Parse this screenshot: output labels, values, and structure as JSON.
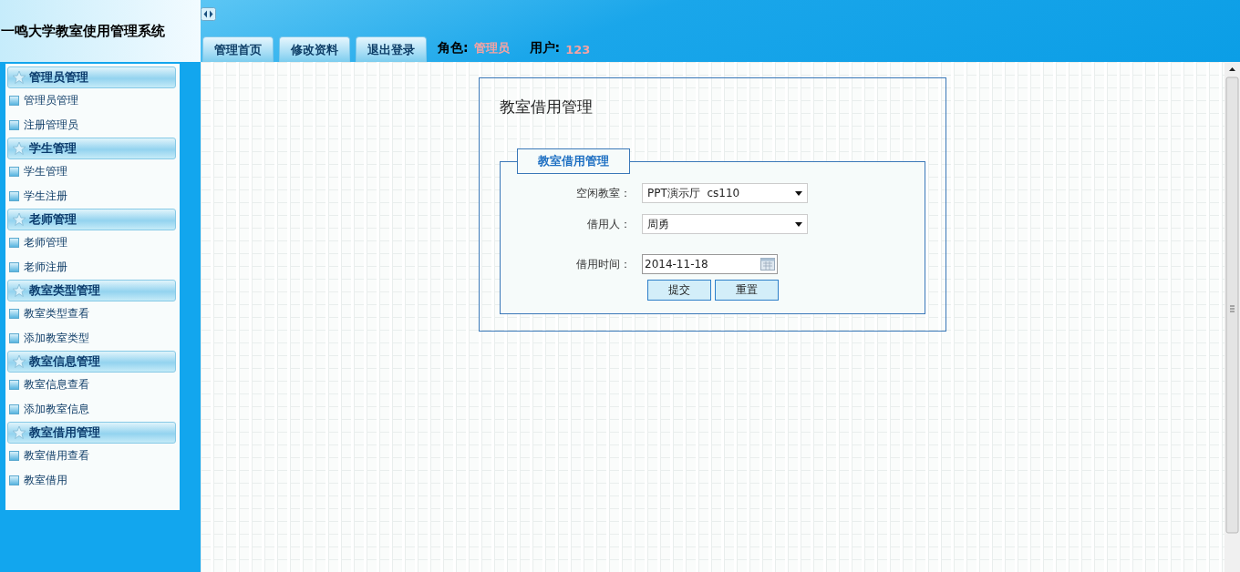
{
  "header": {
    "title": "一鸣大学教室使用管理系统",
    "nav": [
      "管理首页",
      "修改资料",
      "退出登录"
    ],
    "role_label": "角色:",
    "role": "管理员",
    "user_label": "用户:",
    "user": "123"
  },
  "sidebar": {
    "groups": [
      {
        "title": "管理员管理",
        "items": [
          "管理员管理",
          "注册管理员"
        ]
      },
      {
        "title": "学生管理",
        "items": [
          "学生管理",
          "学生注册"
        ]
      },
      {
        "title": "老师管理",
        "items": [
          "老师管理",
          "老师注册"
        ]
      },
      {
        "title": "教室类型管理",
        "items": [
          "教室类型查看",
          "添加教室类型"
        ]
      },
      {
        "title": "教室信息管理",
        "items": [
          "教室信息查看",
          "添加教室信息"
        ]
      },
      {
        "title": "教室借用管理",
        "items": [
          "教室借用查看",
          "教室借用"
        ]
      }
    ]
  },
  "page": {
    "title": "教室借用管理",
    "legend": "教室借用管理",
    "fields": [
      {
        "kind": "select",
        "label": "空闲教室：",
        "value": "PPT演示厅  cs110"
      },
      {
        "kind": "select",
        "label": "借用人：",
        "value": "周勇"
      },
      {
        "kind": "date",
        "label": "借用时间：",
        "value": "2014-11-18"
      }
    ],
    "buttons": [
      "提交",
      "重置"
    ]
  }
}
